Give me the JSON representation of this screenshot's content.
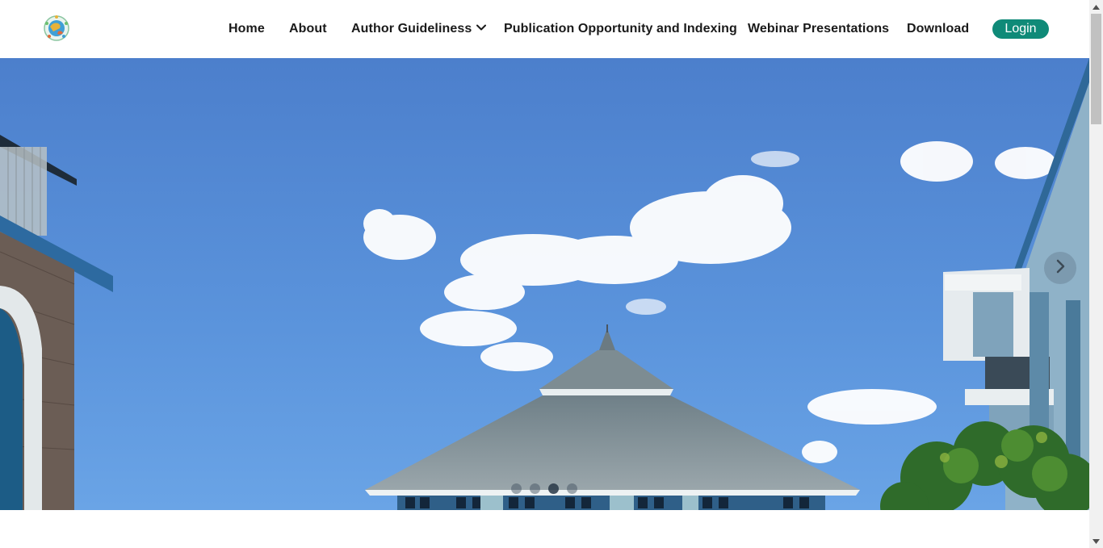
{
  "header": {
    "logo_icon": "conference-logo-icon",
    "nav": {
      "home": "Home",
      "about": "About",
      "author_guideliness": "Author Guideliness",
      "publication": "Publication Opportunity and Indexing",
      "webinar": "Webinar Presentations",
      "download": "Download"
    },
    "login_label": "Login"
  },
  "hero": {
    "next_icon": "chevron-right-icon",
    "slide_count": 4,
    "active_slide": 3
  },
  "colors": {
    "accent": "#0f8a78",
    "nav_text": "#1a1a1a",
    "sky": "#4f83cf"
  }
}
